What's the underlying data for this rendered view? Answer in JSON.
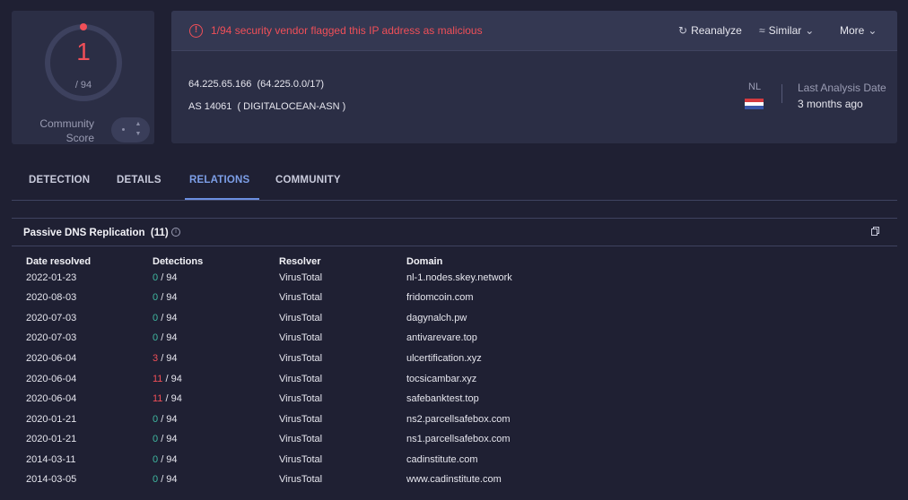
{
  "score": {
    "detections": "1",
    "total": "/ 94",
    "community_label_line1": "Community",
    "community_label_line2": "Score",
    "accent": "#f04f58"
  },
  "alert": {
    "icon": "alert-circle-icon",
    "text": "1/94 security vendor flagged this IP address as malicious"
  },
  "actions": {
    "reanalyze": "Reanalyze",
    "similar": "Similar",
    "more": "More"
  },
  "ip_info": {
    "ip": "64.225.65.166",
    "range": "(64.225.0.0/17)",
    "as_number": "AS 14061",
    "as_name": "( DIGITALOCEAN-ASN )",
    "country": "NL",
    "last_analysis_label": "Last Analysis Date",
    "last_analysis_value": "3 months ago"
  },
  "tabs": [
    {
      "label": "DETECTION",
      "active": false
    },
    {
      "label": "DETAILS",
      "active": false
    },
    {
      "label": "RELATIONS",
      "active": true
    },
    {
      "label": "COMMUNITY",
      "active": false
    }
  ],
  "section": {
    "title": "Passive DNS Replication",
    "count": "(11)",
    "columns": [
      "Date resolved",
      "Detections",
      "Resolver",
      "Domain"
    ]
  },
  "rows": [
    {
      "date": "2022-01-23",
      "det": "0",
      "total": "/ 94",
      "resolver": "VirusTotal",
      "domain": "nl-1.nodes.skey.network"
    },
    {
      "date": "2020-08-03",
      "det": "0",
      "total": "/ 94",
      "resolver": "VirusTotal",
      "domain": "fridomcoin.com"
    },
    {
      "date": "2020-07-03",
      "det": "0",
      "total": "/ 94",
      "resolver": "VirusTotal",
      "domain": "dagynalch.pw"
    },
    {
      "date": "2020-07-03",
      "det": "0",
      "total": "/ 94",
      "resolver": "VirusTotal",
      "domain": "antivarevare.top"
    },
    {
      "date": "2020-06-04",
      "det": "3",
      "total": "/ 94",
      "resolver": "VirusTotal",
      "domain": "ulcertification.xyz"
    },
    {
      "date": "2020-06-04",
      "det": "11",
      "total": "/ 94",
      "resolver": "VirusTotal",
      "domain": "tocsicambar.xyz"
    },
    {
      "date": "2020-06-04",
      "det": "11",
      "total": "/ 94",
      "resolver": "VirusTotal",
      "domain": "safebanktest.top"
    },
    {
      "date": "2020-01-21",
      "det": "0",
      "total": "/ 94",
      "resolver": "VirusTotal",
      "domain": "ns2.parcellsafebox.com"
    },
    {
      "date": "2020-01-21",
      "det": "0",
      "total": "/ 94",
      "resolver": "VirusTotal",
      "domain": "ns1.parcellsafebox.com"
    },
    {
      "date": "2014-03-11",
      "det": "0",
      "total": "/ 94",
      "resolver": "VirusTotal",
      "domain": "cadinstitute.com"
    },
    {
      "date": "2014-03-05",
      "det": "0",
      "total": "/ 94",
      "resolver": "VirusTotal",
      "domain": "www.cadinstitute.com"
    }
  ]
}
